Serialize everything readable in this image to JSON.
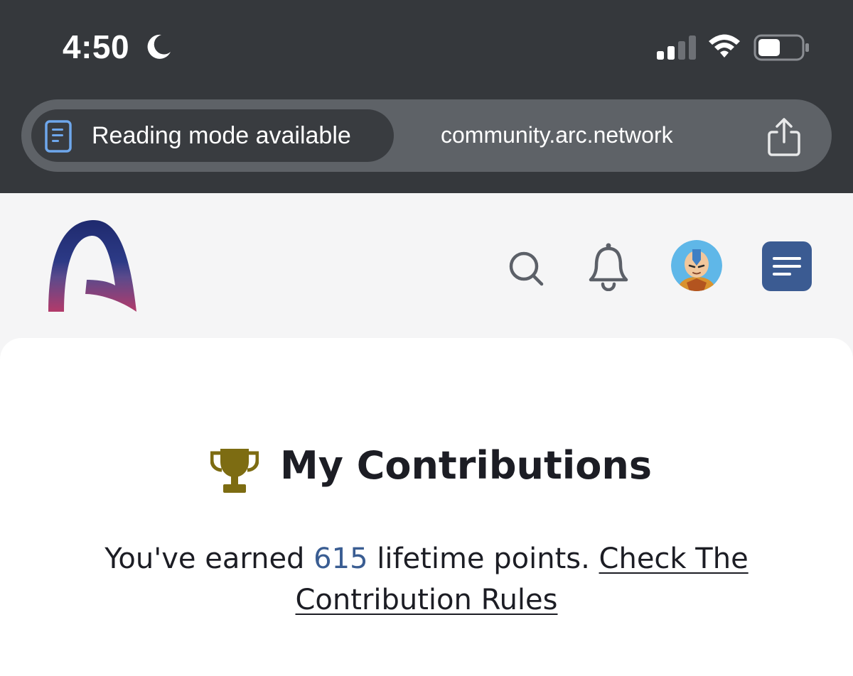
{
  "status_bar": {
    "time": "4:50",
    "focus_icon": "moon-icon",
    "signal_icon": "cellular-signal-icon",
    "wifi_icon": "wifi-icon",
    "battery_icon": "battery-icon",
    "battery_level": 0.45
  },
  "browser": {
    "reader_label": "Reading mode available",
    "reader_icon": "document-icon",
    "url": "community.arc.network",
    "share_icon": "share-icon"
  },
  "header": {
    "logo_icon": "arc-logo",
    "search_icon": "search-icon",
    "notifications_icon": "bell-icon",
    "avatar_icon": "user-avatar",
    "menu_icon": "menu-icon"
  },
  "contributions": {
    "icon": "trophy-icon",
    "title": "My Contributions",
    "points_prefix": "You've earned ",
    "points_value": "615",
    "points_suffix": " lifetime points. ",
    "rules_link": "Check The Contribution Rules"
  },
  "colors": {
    "chrome_background": "#35383c",
    "address_bar": "#5e6267",
    "reader_pill": "#393c40",
    "reader_icon": "#6ea7ec",
    "menu_button": "#3b5b92",
    "trophy": "#7d6c12",
    "points_value": "#3a5d92",
    "logo_top": "#1f2a6e",
    "logo_bottom": "#b33a6a"
  }
}
